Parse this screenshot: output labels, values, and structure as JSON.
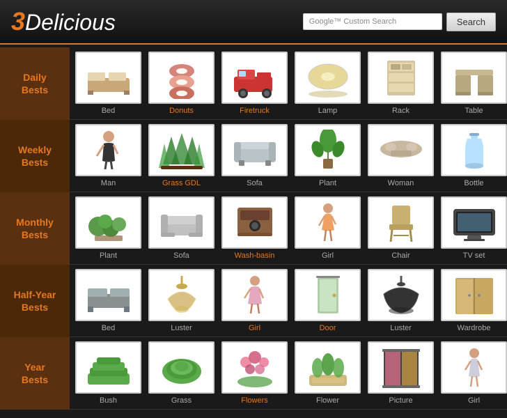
{
  "header": {
    "logo_prefix": "3",
    "logo_suffix": "Delicious",
    "google_label": "Google™ Custom Search",
    "search_placeholder": "",
    "search_button_label": "Search"
  },
  "sidebar": {
    "items": [
      {
        "id": "daily-bests",
        "label": "Daily\nBests"
      },
      {
        "id": "weekly-bests",
        "label": "Weekly\nBests"
      },
      {
        "id": "monthly-bests",
        "label": "Monthly\nBests"
      },
      {
        "id": "halfyear-bests",
        "label": "Half-Year\nBests"
      },
      {
        "id": "year-bests",
        "label": "Year\nBests"
      }
    ]
  },
  "rows": [
    {
      "id": "row-daily",
      "items": [
        {
          "label": "Bed",
          "color": "gray",
          "shape": "bed"
        },
        {
          "label": "Donuts",
          "color": "orange",
          "shape": "donuts"
        },
        {
          "label": "Firetruck",
          "color": "orange",
          "shape": "firetruck"
        },
        {
          "label": "Lamp",
          "color": "gray",
          "shape": "lamp"
        },
        {
          "label": "Rack",
          "color": "gray",
          "shape": "rack"
        },
        {
          "label": "Table",
          "color": "gray",
          "shape": "table"
        }
      ]
    },
    {
      "id": "row-weekly",
      "items": [
        {
          "label": "Man",
          "color": "gray",
          "shape": "man"
        },
        {
          "label": "Grass GDL",
          "color": "orange",
          "shape": "grass"
        },
        {
          "label": "Sofa",
          "color": "gray",
          "shape": "sofa"
        },
        {
          "label": "Plant",
          "color": "gray",
          "shape": "plant"
        },
        {
          "label": "Woman",
          "color": "gray",
          "shape": "woman"
        },
        {
          "label": "Bottle",
          "color": "gray",
          "shape": "bottle"
        }
      ]
    },
    {
      "id": "row-monthly",
      "items": [
        {
          "label": "Plant",
          "color": "gray",
          "shape": "plant2"
        },
        {
          "label": "Sofa",
          "color": "gray",
          "shape": "sofa2"
        },
        {
          "label": "Wash-basin",
          "color": "orange",
          "shape": "washbasin"
        },
        {
          "label": "Girl",
          "color": "gray",
          "shape": "girl"
        },
        {
          "label": "Chair",
          "color": "gray",
          "shape": "chair"
        },
        {
          "label": "TV set",
          "color": "gray",
          "shape": "tvset"
        }
      ]
    },
    {
      "id": "row-halfyear",
      "items": [
        {
          "label": "Bed",
          "color": "gray",
          "shape": "bed2"
        },
        {
          "label": "Luster",
          "color": "gray",
          "shape": "luster"
        },
        {
          "label": "Girl",
          "color": "orange",
          "shape": "girl2"
        },
        {
          "label": "Door",
          "color": "orange",
          "shape": "door"
        },
        {
          "label": "Luster",
          "color": "gray",
          "shape": "luster2"
        },
        {
          "label": "Wardrobe",
          "color": "gray",
          "shape": "wardrobe"
        }
      ]
    },
    {
      "id": "row-year",
      "items": [
        {
          "label": "Bush",
          "color": "gray",
          "shape": "bush"
        },
        {
          "label": "Grass",
          "color": "gray",
          "shape": "grass2"
        },
        {
          "label": "Flowers",
          "color": "orange",
          "shape": "flowers"
        },
        {
          "label": "Flower",
          "color": "gray",
          "shape": "flower"
        },
        {
          "label": "Picture",
          "color": "gray",
          "shape": "picture"
        },
        {
          "label": "Girl",
          "color": "gray",
          "shape": "girl3"
        }
      ]
    }
  ]
}
